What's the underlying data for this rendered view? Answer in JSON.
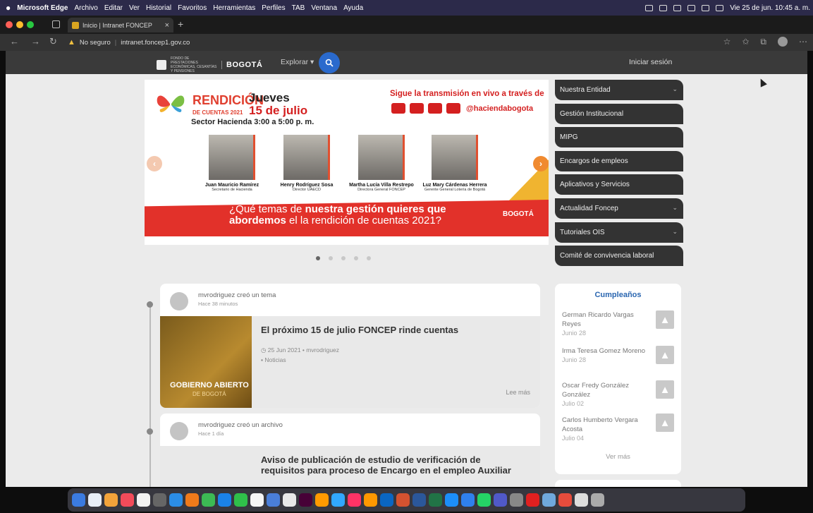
{
  "menubar": {
    "app": "Microsoft Edge",
    "items": [
      "Archivo",
      "Editar",
      "Ver",
      "Historial",
      "Favoritos",
      "Herramientas",
      "Perfiles",
      "TAB",
      "Ventana",
      "Ayuda"
    ],
    "clock": "Vie 25 de jun.  10:45 a. m."
  },
  "browser": {
    "tab_title": "Inicio | Intranet FONCEP",
    "security": "No seguro",
    "url": "intranet.foncep1.gov.co"
  },
  "site": {
    "logo_text": "FONDO DE PRESTACIONES ECONÓMICAS, CESANTÍAS Y PENSIONES",
    "bogota": "BOGOTÁ",
    "explore": "Explorar ▾",
    "login": "Iniciar sesión"
  },
  "banner": {
    "rendicion": "RENDICIÓN",
    "rendicion_sub": "DE CUENTAS 2021",
    "day": "Jueves",
    "date": "15 de julio",
    "sector": "Sector Hacienda  3:00 a 5:00 p. m.",
    "sigue": "Sigue la transmisión en vivo a través de",
    "handle": "@haciendabogota",
    "people": [
      {
        "name": "Juan Mauricio Ramírez",
        "role": "Secretario de Hacienda"
      },
      {
        "name": "Henry Rodríguez Sosa",
        "role": "Director UAECD"
      },
      {
        "name": "Martha Lucía Villa Restrepo",
        "role": "Directora General FONCEP"
      },
      {
        "name": "Luz Mary Cárdenas Herrera",
        "role": "Gerente General Lotería de Bogotá"
      }
    ],
    "question_a": "¿Qué temas de ",
    "question_b": "nuestra gestión quieres que",
    "question_c": "abordemos",
    "question_d": " el la rendición de cuentas 2021?",
    "footer_logo": "BOGOTÁ"
  },
  "menu": [
    {
      "label": "Nuestra Entidad",
      "chev": true
    },
    {
      "label": "Gestión Institucional",
      "chev": false
    },
    {
      "label": "MIPG",
      "chev": false
    },
    {
      "label": "Encargos de empleos",
      "chev": false
    },
    {
      "label": "Aplicativos y Servicios",
      "chev": false
    },
    {
      "label": "Actualidad Foncep",
      "chev": true
    },
    {
      "label": "Tutoriales OIS",
      "chev": true
    },
    {
      "label": "Comité de convivencia laboral",
      "chev": false
    }
  ],
  "posts": [
    {
      "action": "mvrodriguez creó un tema",
      "time": "Hace 38 minutos",
      "title": "El próximo 15 de julio FONCEP rinde cuentas",
      "meta_date": "25 Jun 2021 • mvrodriguez",
      "meta_cat": "Noticias",
      "image_title": "GOBIERNO ABIERTO",
      "image_sub": "DE BOGOTÁ",
      "read_more": "Lee más"
    },
    {
      "action": "mvrodriguez creó un archivo",
      "time": "Hace 1 día",
      "title": "Aviso de publicación de estudio de verificación de requisitos para proceso de Encargo en el empleo Auxiliar"
    }
  ],
  "birthdays": {
    "title": "Cumpleaños",
    "people": [
      {
        "name": "German Ricardo Vargas Reyes",
        "date": "Junio 28"
      },
      {
        "name": "Irma Teresa Gomez Moreno",
        "date": "Junio 28"
      },
      {
        "name": "Oscar Fredy González González",
        "date": "Julio 02"
      },
      {
        "name": "Carlos Humberto Vergara Acosta",
        "date": "Julio 04"
      }
    ],
    "more": "Ver más"
  },
  "dock_icons": [
    "finder-icon",
    "launchpad-icon",
    "photos-icon",
    "music-icon",
    "calendar-icon",
    "notes-icon",
    "safari-icon",
    "firefox-icon",
    "chrome-icon",
    "edge-icon",
    "facetime-icon",
    "reminders-icon",
    "keynote-icon",
    "gmail-icon",
    "xd-icon",
    "illustrator-icon",
    "photoshop-icon",
    "indesign-icon",
    "sublime-icon",
    "outlook-icon",
    "powerpoint-icon",
    "word-icon",
    "excel-icon",
    "appstore-icon",
    "vscode-icon",
    "whatsapp-icon",
    "teams-icon",
    "system-icon",
    "acrobat-icon",
    "preview-icon",
    "office-icon",
    "file-icon",
    "trash-icon"
  ]
}
